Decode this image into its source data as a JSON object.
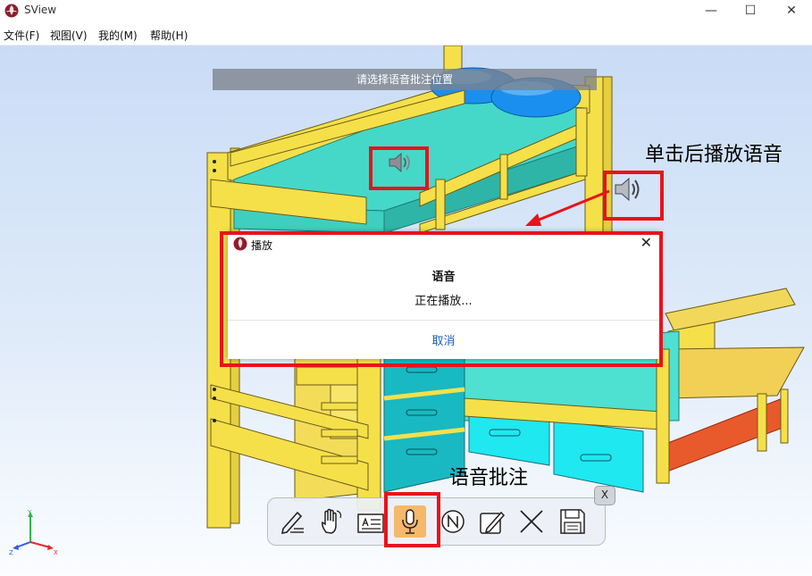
{
  "window": {
    "title": "SView",
    "controls": [
      "—",
      "☐",
      "✕"
    ]
  },
  "menu": [
    "文件(F)",
    "视图(V)",
    "我的(M)",
    "帮助(H)"
  ],
  "viewport": {
    "hint": "请选择语音批注位置",
    "callout_play": "单击后播放语音",
    "callout_annotation": "语音批注"
  },
  "dialog": {
    "title": "播放",
    "close": "✕",
    "heading": "语音",
    "message": "正在播放...",
    "cancel": "取消"
  },
  "toolbar": {
    "close": "X",
    "tools": [
      {
        "name": "annotation-pen-tool",
        "icon": "pen-lines-icon"
      },
      {
        "name": "pan-hand-tool",
        "icon": "hand-icon"
      },
      {
        "name": "text-annotation-tool",
        "icon": "text-box-icon"
      },
      {
        "name": "voice-annotation-tool",
        "icon": "microphone-icon",
        "active": true
      },
      {
        "name": "note-annotation-tool",
        "icon": "circle-n-icon"
      },
      {
        "name": "edit-annotation-tool",
        "icon": "edit-pencil-icon"
      },
      {
        "name": "delete-annotation-tool",
        "icon": "x-icon"
      },
      {
        "name": "save-annotation-tool",
        "icon": "floppy-disk-icon"
      }
    ]
  },
  "axis_triad": {
    "y": "Y",
    "z": "Z",
    "x": "X"
  },
  "colors": {
    "highlight_red": "#e8131b",
    "active_tool": "#f6b86b",
    "bed_frame": "#f5e04a",
    "mattress": "#39d2c0",
    "pillow": "#1a8ff0"
  }
}
